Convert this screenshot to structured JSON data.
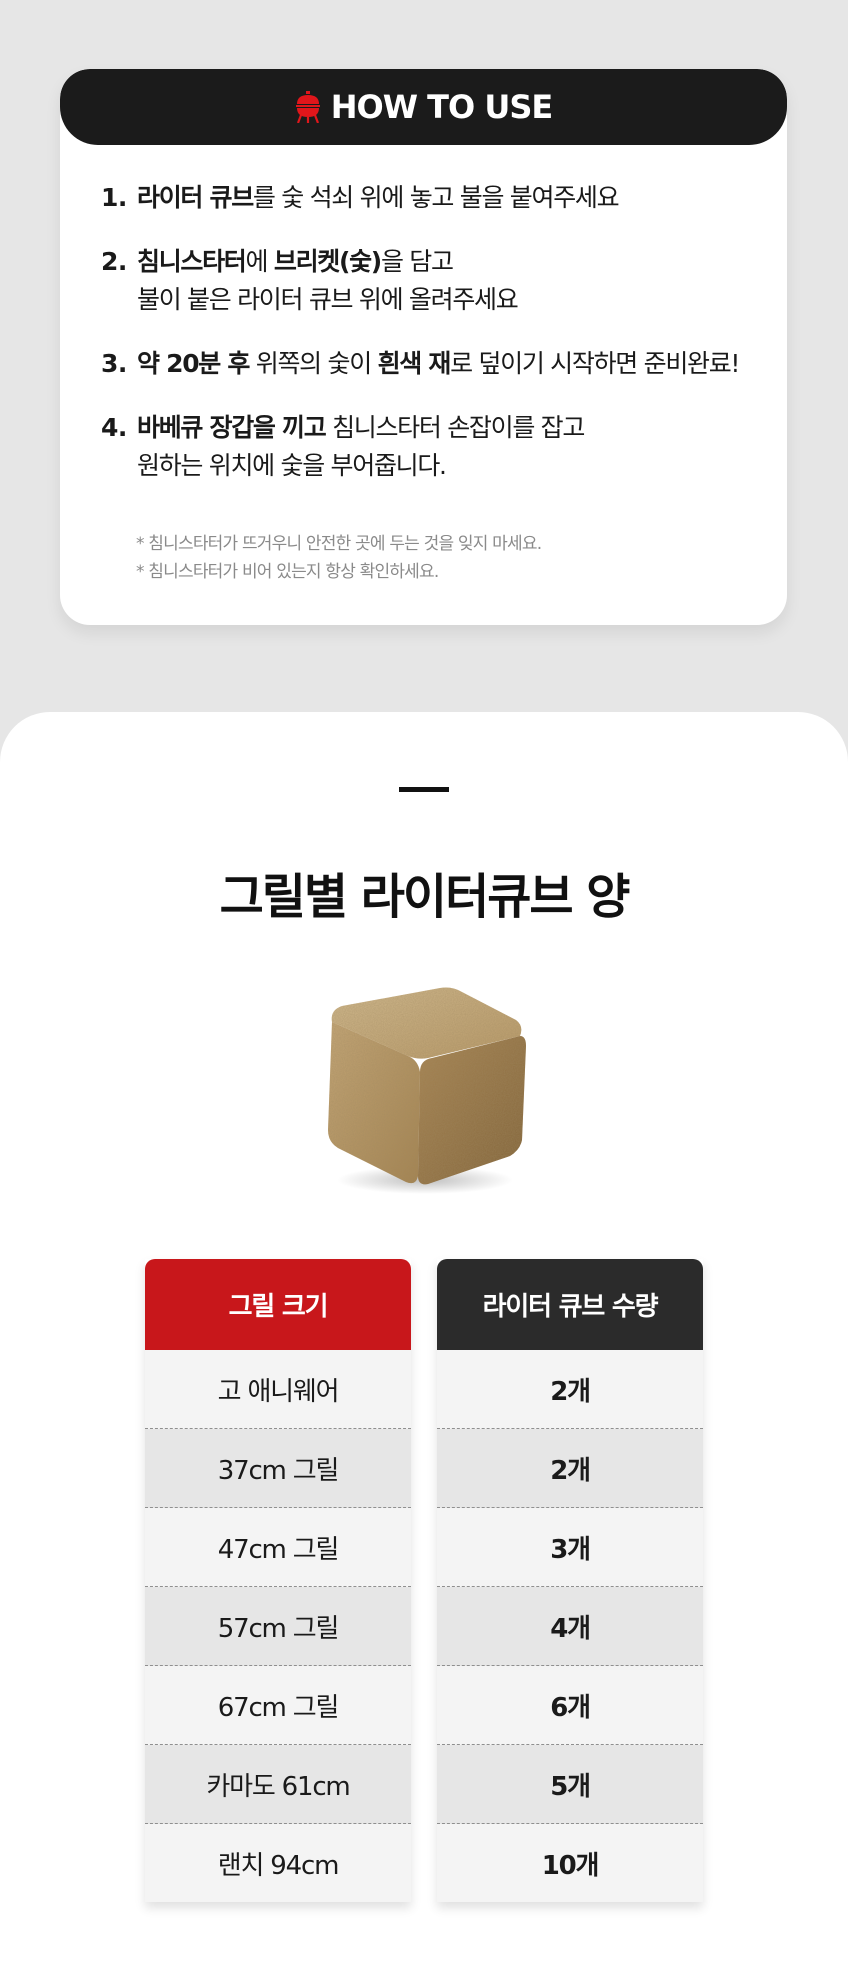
{
  "howto": {
    "title": "HOW TO USE",
    "steps": [
      {
        "num": "1.",
        "parts": [
          {
            "t": "라이터 큐브",
            "b": true
          },
          {
            "t": "를 숯 석쇠 위에 놓고 불을 붙여주세요",
            "b": false
          }
        ]
      },
      {
        "num": "2.",
        "parts": [
          {
            "t": "침니스타터",
            "b": true
          },
          {
            "t": "에 ",
            "b": false
          },
          {
            "t": "브리켓(숯)",
            "b": true
          },
          {
            "t": "을 담고",
            "b": false
          },
          {
            "br": true
          },
          {
            "t": "불이 붙은 라이터 큐브 위에 올려주세요",
            "b": false
          }
        ]
      },
      {
        "num": "3.",
        "parts": [
          {
            "t": "약 20분 후",
            "b": true
          },
          {
            "t": " 위쪽의 숯이 ",
            "b": false
          },
          {
            "t": "흰색 재",
            "b": true
          },
          {
            "t": "로 덮이기 시작하면 준비완료!",
            "b": false
          }
        ]
      },
      {
        "num": "4.",
        "parts": [
          {
            "t": "바베큐 장갑을 끼고",
            "b": true
          },
          {
            "t": " 침니스타터 손잡이를 잡고",
            "b": false
          },
          {
            "br": true
          },
          {
            "t": "원하는 위치에 숯을 부어줍니다.",
            "b": false
          }
        ]
      }
    ],
    "notes": [
      "* 침니스타터가 뜨거우니 안전한 곳에 두는 것을 잊지 마세요.",
      "* 침니스타터가 비어 있는지 항상 확인하세요."
    ]
  },
  "section": {
    "title": "그릴별 라이터큐브 양"
  },
  "table": {
    "left_header": "그릴 크기",
    "right_header": "라이터 큐브 수량",
    "rows": [
      {
        "size": "고 애니웨어",
        "qty": "2개"
      },
      {
        "size": "37cm 그릴",
        "qty": "2개"
      },
      {
        "size": "47cm 그릴",
        "qty": "3개"
      },
      {
        "size": "57cm 그릴",
        "qty": "4개"
      },
      {
        "size": "67cm 그릴",
        "qty": "6개"
      },
      {
        "size": "카마도 61cm",
        "qty": "5개"
      },
      {
        "size": "랜치 94cm",
        "qty": "10개"
      }
    ]
  },
  "colors": {
    "accent_red": "#c8171b",
    "dark": "#1b1b1b"
  }
}
